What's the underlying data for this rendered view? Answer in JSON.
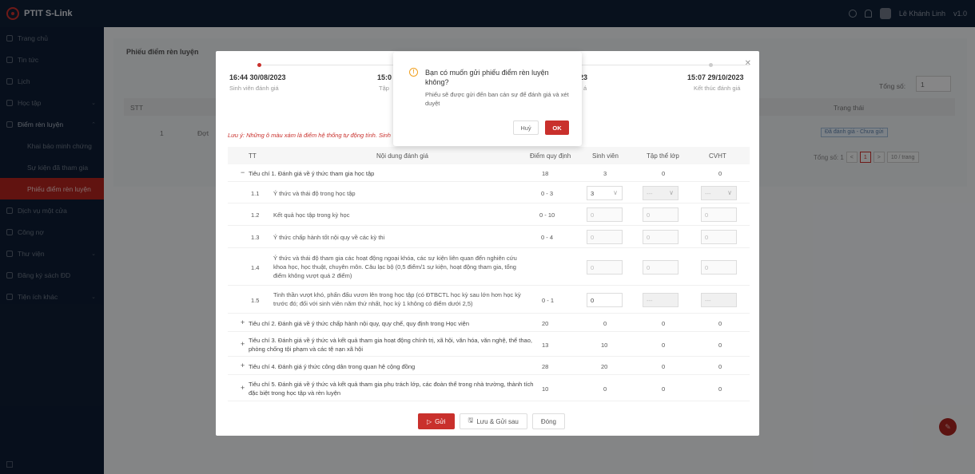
{
  "app": {
    "title": "PTIT S-Link",
    "version": "v1.0",
    "user": "Lê Khánh Linh"
  },
  "sidebar": {
    "items": [
      {
        "label": "Trang chủ"
      },
      {
        "label": "Tin tức"
      },
      {
        "label": "Lịch"
      },
      {
        "label": "Học tập"
      },
      {
        "label": "Điểm rèn luyện"
      },
      {
        "label": "Khai báo minh chứng"
      },
      {
        "label": "Sự kiện đã tham gia"
      },
      {
        "label": "Phiếu điểm rèn luyện"
      },
      {
        "label": "Dịch vụ một cửa"
      },
      {
        "label": "Công nợ"
      },
      {
        "label": "Thư viện"
      },
      {
        "label": "Đăng ký sách ĐD"
      },
      {
        "label": "Tiện ích khác"
      }
    ]
  },
  "background": {
    "page_title": "Phiếu điểm rèn luyện",
    "total_label": "Tổng số:",
    "total_value": "1",
    "col_stt": "STT",
    "col_status": "Trạng thái",
    "row_stt": "1",
    "row_text": "Đợt",
    "status_badge": "Đã đánh giá - Chưa gửi",
    "pager_total": "Tổng số: 1",
    "pager_prev": "<",
    "pager_page": "1",
    "pager_next": ">",
    "pager_size": "10 / trang"
  },
  "modal": {
    "steps": [
      {
        "time": "16:44 30/08/2023",
        "label": "Sinh viên đánh giá",
        "color": "#c9302c"
      },
      {
        "time": "15:0",
        "label": "Tập",
        "color": "#cccccc"
      },
      {
        "time": "023",
        "label": "á",
        "color": "#cccccc"
      },
      {
        "time": "15:07 29/10/2023",
        "label": "Kết thúc đánh giá",
        "color": "#cccccc"
      }
    ],
    "note": "Lưu ý: Những ô màu xám là điểm hệ thống tự động tính. Sinh",
    "headers": {
      "tt": "TT",
      "content": "Nội dung đánh giá",
      "rule": "Điểm quy định",
      "student": "Sinh viên",
      "class": "Tập thể lớp",
      "advisor": "CVHT"
    },
    "criteria": [
      {
        "toggle": "−",
        "text": "Tiêu chí 1. Đánh giá về ý thức tham gia học tập",
        "rule": "18",
        "student": "3",
        "class": "0",
        "advisor": "0"
      },
      {
        "toggle": "+",
        "text": "Tiêu chí 2. Đánh giá về ý thức chấp hành nội quy, quy chế, quy định trong Học viện",
        "rule": "20",
        "student": "0",
        "class": "0",
        "advisor": "0"
      },
      {
        "toggle": "+",
        "text": "Tiêu chí 3. Đánh giá về ý thức và kết quả tham gia hoạt động chính trị, xã hội, văn hóa, văn nghệ, thể thao, phòng chống tội phạm và các tệ nạn xã hội",
        "rule": "13",
        "student": "10",
        "class": "0",
        "advisor": "0"
      },
      {
        "toggle": "+",
        "text": "Tiêu chí 4. Đánh giá ý thức công dân trong quan hệ cộng đồng",
        "rule": "28",
        "student": "20",
        "class": "0",
        "advisor": "0"
      },
      {
        "toggle": "+",
        "text": "Tiêu chí 5. Đánh giá về ý thức và kết quả tham gia phụ trách lớp, các đoàn thể trong nhà trường, thành tích đặc biệt trong học tập và rèn luyện",
        "rule": "10",
        "student": "0",
        "class": "0",
        "advisor": "0"
      }
    ],
    "sub_items": [
      {
        "tt": "1.1",
        "text": "Ý thức và thái độ trong học tập",
        "rule": "0 - 3",
        "student": "3",
        "class": "---",
        "advisor": "---"
      },
      {
        "tt": "1.2",
        "text": "Kết quả học tập trong kỳ học",
        "rule": "0 - 10",
        "student": "0",
        "class": "0",
        "advisor": "0"
      },
      {
        "tt": "1.3",
        "text": "Ý thức chấp hành tốt nội quy về các kỳ thi",
        "rule": "0 - 4",
        "student": "0",
        "class": "0",
        "advisor": "0"
      },
      {
        "tt": "1.4",
        "text": "Ý thức và thái độ tham gia các hoạt động ngoại khóa, các sự kiện liên quan đến nghiên cứu khoa học, học thuật, chuyên môn. Câu lạc bộ (0,5 điểm/1 sự kiện, hoạt động tham gia, tổng điểm không vượt quá 2 điểm)",
        "rule": "",
        "student": "0",
        "class": "0",
        "advisor": "0"
      },
      {
        "tt": "1.5",
        "text": "Tinh thần vượt khó, phấn đấu vươn lên trong học tập (có ĐTBCTL học kỳ sau lớn hơn học kỳ trước đó; đối với sinh viên năm thứ nhất, học kỳ 1 không có điểm dưới 2,5)",
        "rule": "0 - 1",
        "student": "0",
        "class": "---",
        "advisor": "---"
      }
    ],
    "buttons": {
      "send": "Gửi",
      "save": "Lưu & Gửi sau",
      "close": "Đóng"
    }
  },
  "confirm": {
    "title": "Bạn có muốn gửi phiếu điểm rèn luyện không?",
    "message": "Phiếu sẽ được gửi đến ban cán sự để đánh giá và xét duyệt",
    "cancel": "Huỷ",
    "ok": "OK"
  },
  "colors": {
    "accent": "#c9302c",
    "sidebar": "#0e1d33",
    "topbar": "#0f1f35"
  }
}
